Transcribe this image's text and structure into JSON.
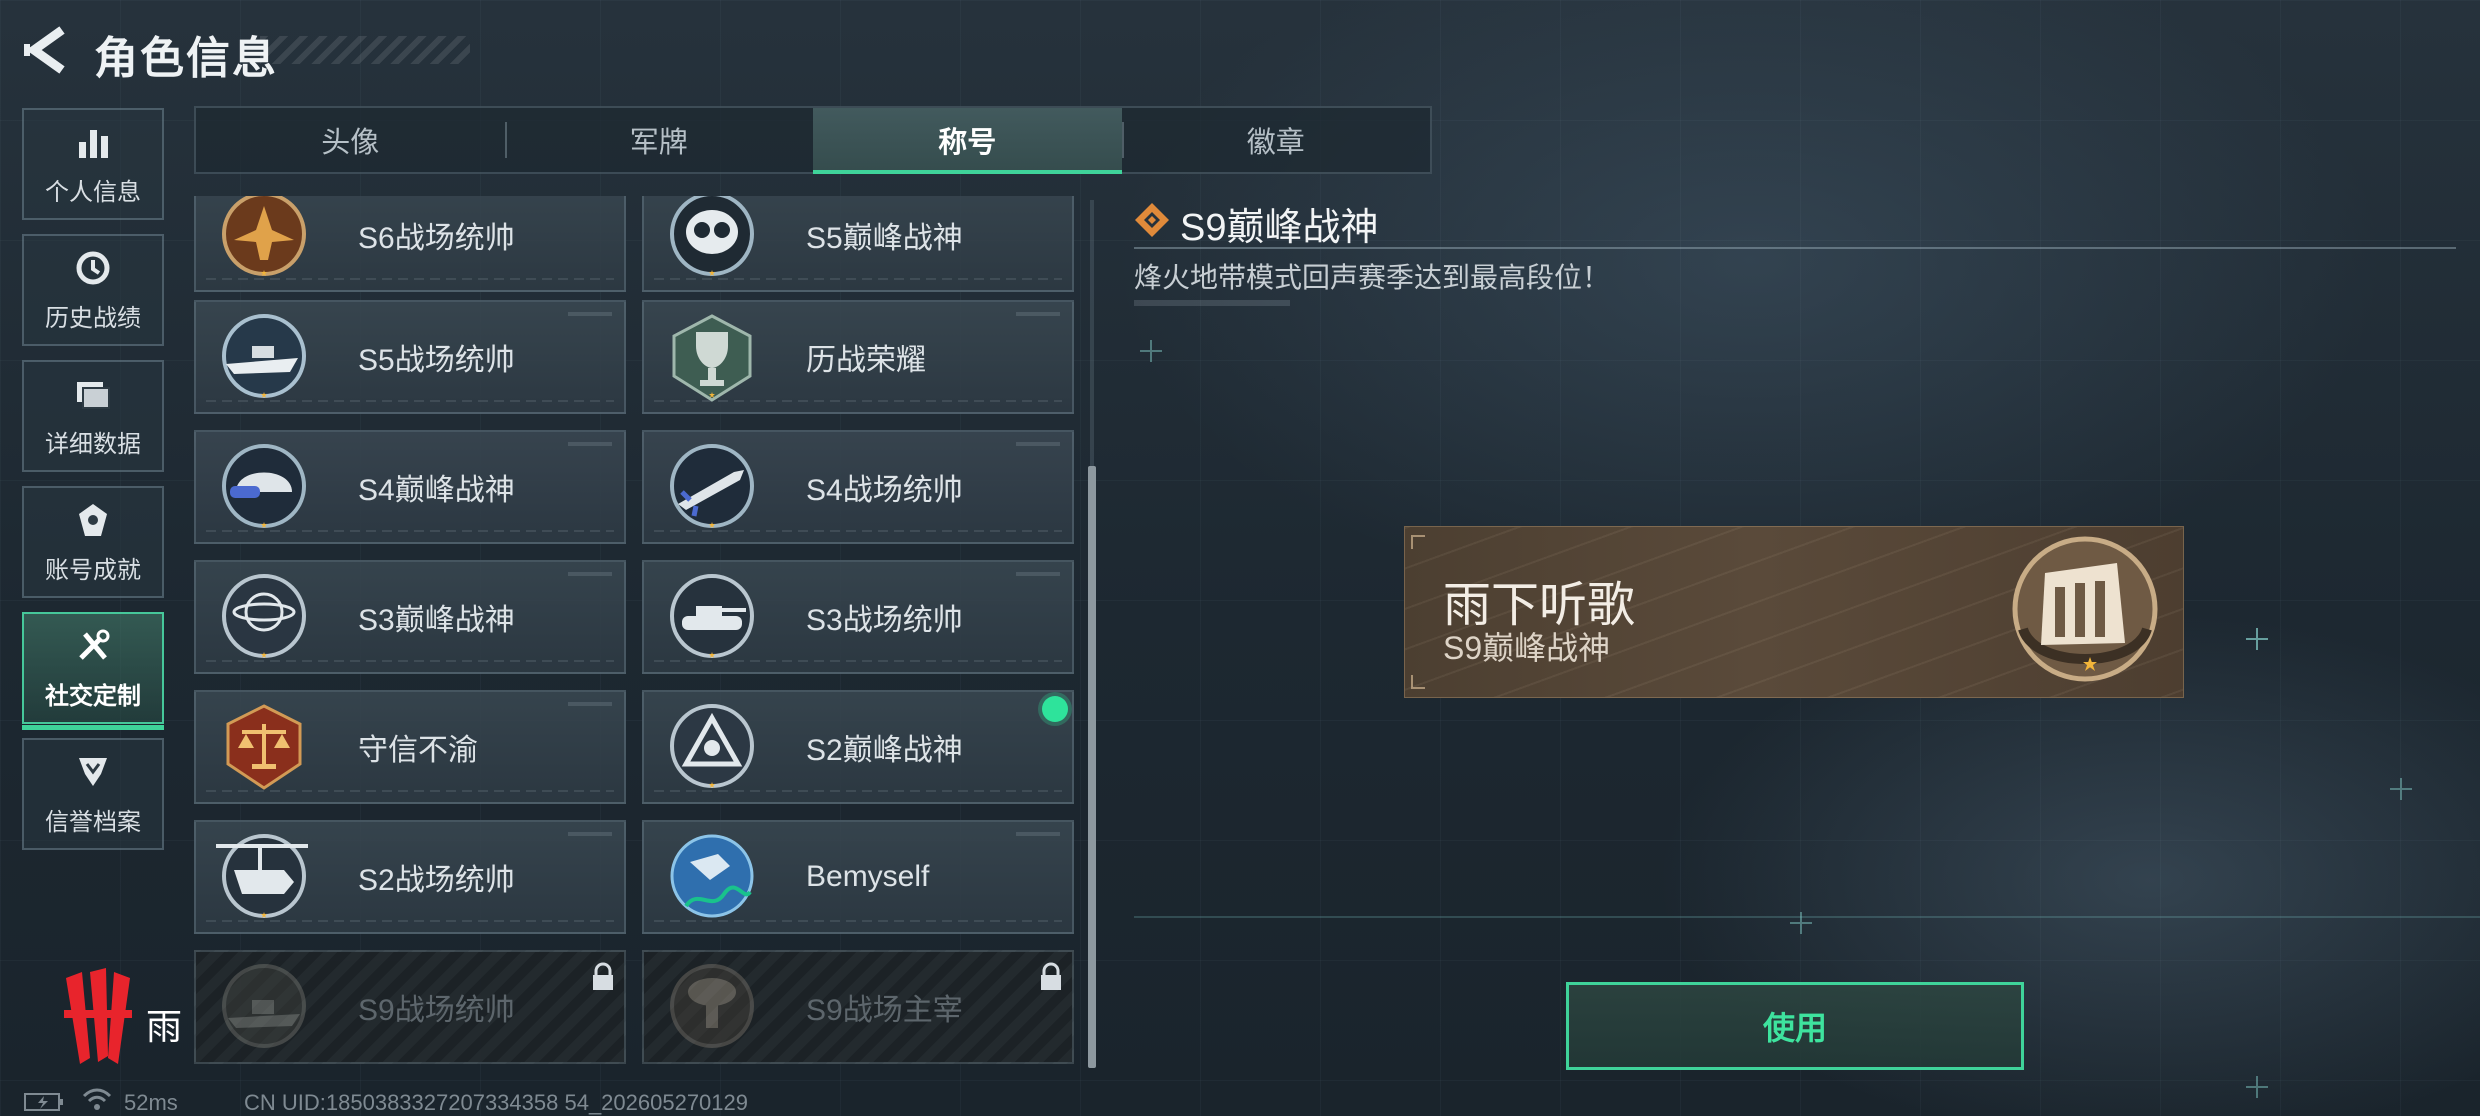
{
  "header": {
    "title": "角色信息"
  },
  "sidebar": {
    "items": [
      {
        "label": "个人信息",
        "icon": "bar-chart-icon"
      },
      {
        "label": "历史战绩",
        "icon": "history-icon"
      },
      {
        "label": "详细数据",
        "icon": "folder-icon"
      },
      {
        "label": "账号成就",
        "icon": "achievement-icon"
      },
      {
        "label": "社交定制",
        "icon": "tools-icon",
        "active": true
      },
      {
        "label": "信誉档案",
        "icon": "credit-icon"
      }
    ]
  },
  "tabs": [
    {
      "label": "头像"
    },
    {
      "label": "军牌"
    },
    {
      "label": "称号",
      "active": true
    },
    {
      "label": "徽章"
    }
  ],
  "titles": [
    {
      "label": "S6战场统帅",
      "emblem": "jet-emblem-icon",
      "locked": false
    },
    {
      "label": "S5巅峰战神",
      "emblem": "mask-emblem-icon",
      "locked": false
    },
    {
      "label": "S5战场统帅",
      "emblem": "boat-emblem-icon",
      "locked": false
    },
    {
      "label": "历战荣耀",
      "emblem": "trophy-emblem-icon",
      "locked": false
    },
    {
      "label": "S4巅峰战神",
      "emblem": "helmet-emblem-icon",
      "locked": false
    },
    {
      "label": "S4战场统帅",
      "emblem": "missile-emblem-icon",
      "locked": false
    },
    {
      "label": "S3巅峰战神",
      "emblem": "globe-emblem-icon",
      "locked": false
    },
    {
      "label": "S3战场统帅",
      "emblem": "tank-emblem-icon",
      "locked": false
    },
    {
      "label": "守信不渝",
      "emblem": "scales-emblem-icon",
      "locked": false
    },
    {
      "label": "S2巅峰战神",
      "emblem": "triangle-emblem-icon",
      "locked": false,
      "equipped": true
    },
    {
      "label": "S2战场统帅",
      "emblem": "helicopter-emblem-icon",
      "locked": false
    },
    {
      "label": "Bemyself",
      "emblem": "signature-emblem-icon",
      "locked": false
    },
    {
      "label": "S9战场统帅",
      "emblem": "warship-emblem-icon",
      "locked": true
    },
    {
      "label": "S9战场主宰",
      "emblem": "mushroom-cloud-emblem-icon",
      "locked": true
    }
  ],
  "detail": {
    "title": "S9巅峰战神",
    "description": "烽火地带模式回声赛季达到最高段位！"
  },
  "preview": {
    "player_name": "雨下听歌",
    "title": "S9巅峰战神"
  },
  "actions": {
    "use_label": "使用"
  },
  "status": {
    "brand_text": "雨",
    "ping": "52ms",
    "uid": "CN UID:1850383327207334358 54_202605270129"
  },
  "colors": {
    "accent": "#3fd39a",
    "equipped_dot": "#2ee39b",
    "plate_bg": "#564636",
    "title_icon": "#e08a3a"
  }
}
